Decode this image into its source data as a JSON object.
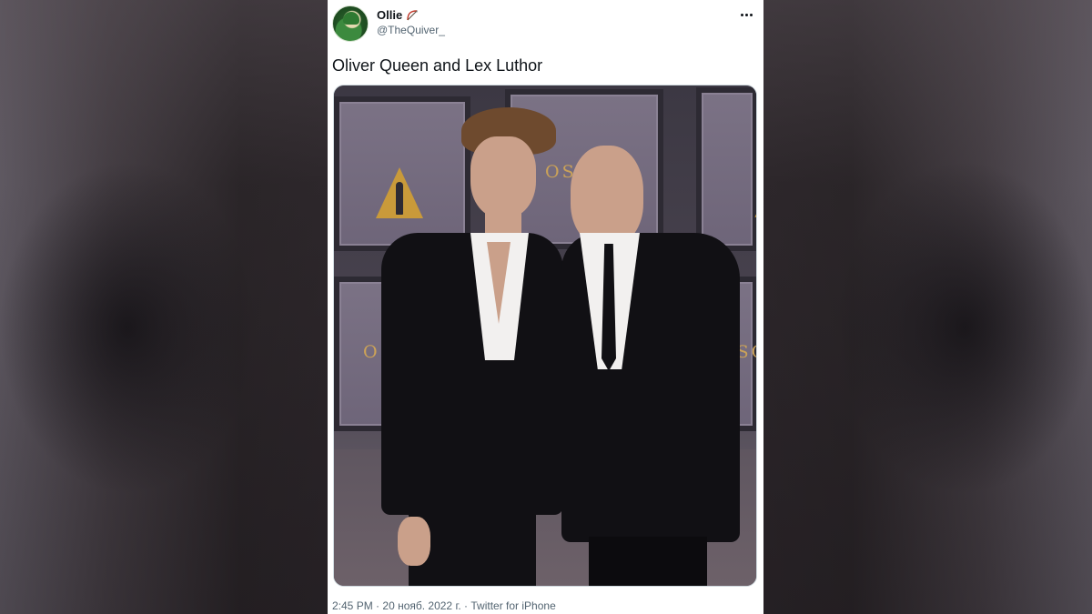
{
  "tweet": {
    "author": {
      "display_name": "Ollie",
      "display_name_emoji_icon": "bow-and-arrow-icon",
      "handle": "@TheQuiver_",
      "avatar_icon": "green-arrow-avatar"
    },
    "text": "Oliver Queen and Lex Luthor",
    "media": {
      "type": "photo",
      "wall_text_left": "OS",
      "wall_text_right": "OSC",
      "wall_text_top": "OSC"
    },
    "meta": {
      "time": "2:45 PM",
      "date": "20 нояб. 2022 г.",
      "separator": "·",
      "source": "Twitter for iPhone"
    },
    "more_icon": "more-options-icon"
  },
  "colors": {
    "text_primary": "#0f1419",
    "text_secondary": "#536471",
    "card_bg": "#ffffff",
    "oscar_gold": "#c99a3a"
  }
}
